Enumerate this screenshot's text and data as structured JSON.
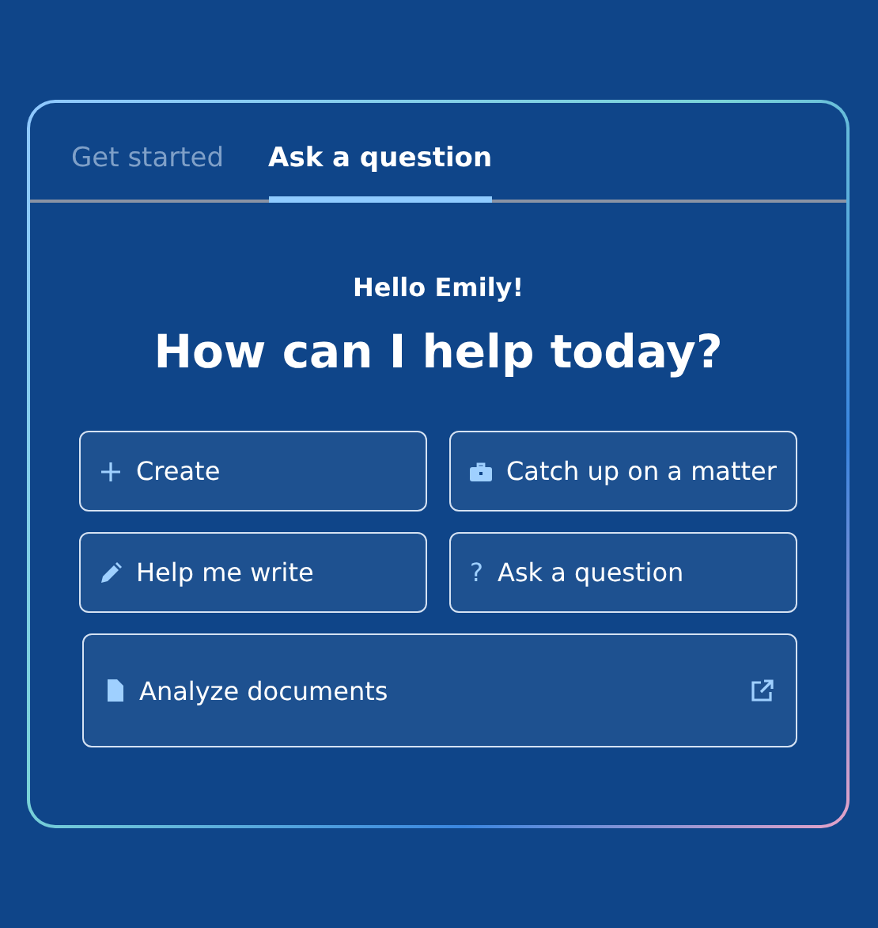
{
  "tabs": [
    {
      "label": "Get started",
      "selected": false
    },
    {
      "label": "Ask a question",
      "selected": true
    }
  ],
  "greeting": "Hello Emily!",
  "headline": "How can I help today?",
  "actions": [
    {
      "label": "Create",
      "kind": "plus"
    },
    {
      "label": "Catch up on a matter",
      "kind": "briefcase"
    },
    {
      "label": "Help me write",
      "kind": "pencil"
    },
    {
      "label": "Ask a question",
      "kind": "question",
      "glyph": "?"
    },
    {
      "label": "Analyze documents",
      "kind": "document"
    }
  ]
}
